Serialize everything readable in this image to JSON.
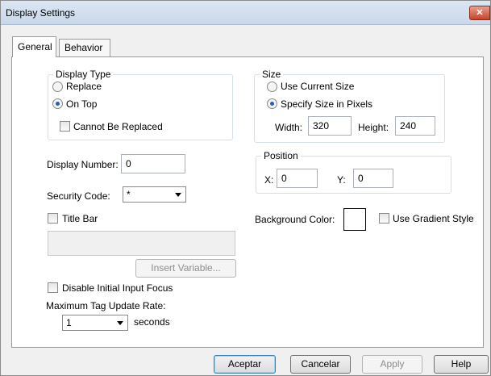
{
  "window": {
    "title": "Display Settings",
    "close_glyph": "✕"
  },
  "tabs": [
    {
      "label": "General",
      "active": true
    },
    {
      "label": "Behavior",
      "active": false
    }
  ],
  "display_type": {
    "legend": "Display Type",
    "replace_label": "Replace",
    "on_top_label": "On Top",
    "selected": "On Top",
    "cannot_be_replaced_label": "Cannot Be Replaced",
    "cannot_be_replaced_checked": false
  },
  "size": {
    "legend": "Size",
    "use_current_label": "Use Current Size",
    "specify_label": "Specify Size in Pixels",
    "selected": "Specify Size in Pixels",
    "width_label": "Width:",
    "width_value": "320",
    "height_label": "Height:",
    "height_value": "240"
  },
  "display_number": {
    "label": "Display Number:",
    "value": "0"
  },
  "security_code": {
    "label": "Security Code:",
    "value": "*"
  },
  "position": {
    "legend": "Position",
    "x_label": "X:",
    "x_value": "0",
    "y_label": "Y:",
    "y_value": "0"
  },
  "title_bar": {
    "label": "Title Bar",
    "checked": false,
    "text_value": ""
  },
  "insert_variable_label": "Insert Variable...",
  "background": {
    "label": "Background Color:",
    "color": "#ffffff",
    "gradient_label": "Use Gradient Style",
    "gradient_checked": false
  },
  "disable_focus": {
    "label": "Disable Initial Input Focus",
    "checked": false
  },
  "update_rate": {
    "label": "Maximum Tag Update Rate:",
    "value": "1",
    "unit": "seconds"
  },
  "buttons": {
    "ok": "Aceptar",
    "cancel": "Cancelar",
    "apply": "Apply",
    "help": "Help"
  }
}
